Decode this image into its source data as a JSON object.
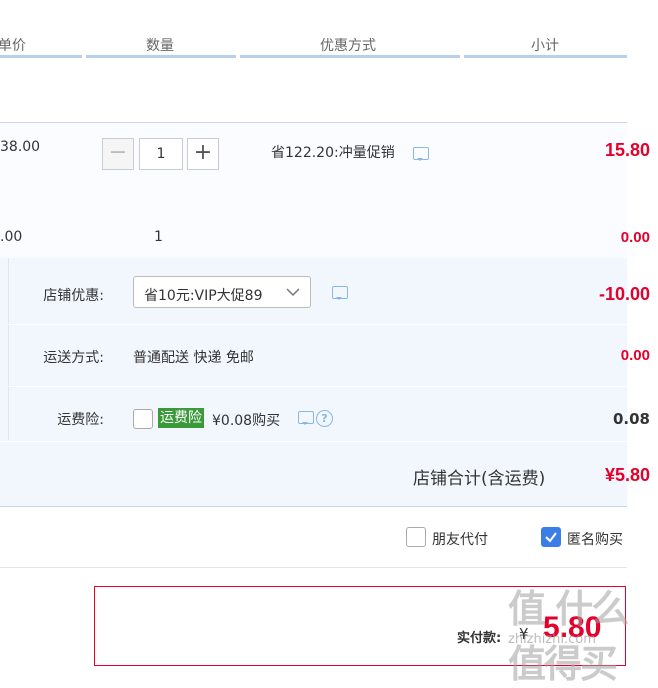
{
  "header": {
    "col_price": "单价",
    "col_qty": "数量",
    "col_discount": "优惠方式",
    "col_subtotal": "小计"
  },
  "items": [
    {
      "price": "38.00",
      "qty": "1",
      "promo": "省122.20:冲量促销",
      "subtotal": "15.80"
    },
    {
      "price": ".00",
      "qty": "1",
      "subtotal": "0.00"
    }
  ],
  "stepper": {
    "minus": "−",
    "plus": "+"
  },
  "shop": {
    "discount_label": "店铺优惠:",
    "discount_selected": "省10元:VIP大促89",
    "discount_amount": "-10.00",
    "shipping_label": "运送方式:",
    "shipping_value": "普通配送 快递 免邮",
    "shipping_amount": "0.00",
    "insurance_label": "运费险:",
    "insurance_badge": "运费险",
    "insurance_text": "¥0.08购买",
    "insurance_amount": "0.08",
    "total_label": "店铺合计(含运费)",
    "total_value": "¥5.80"
  },
  "options": {
    "friend_pay": "朋友代付",
    "anonymous": "匿名购买"
  },
  "pay": {
    "label": "实付款:",
    "currency": "¥",
    "amount": "5.80"
  },
  "watermark": {
    "text": "值 什么值得买",
    "url": "zhizhizhi.com"
  },
  "colors": {
    "accent_red": "#e4002b",
    "blue_line": "#b8d0ea",
    "check_blue": "#3b7fe6",
    "badge_green": "#3a9a3a"
  }
}
